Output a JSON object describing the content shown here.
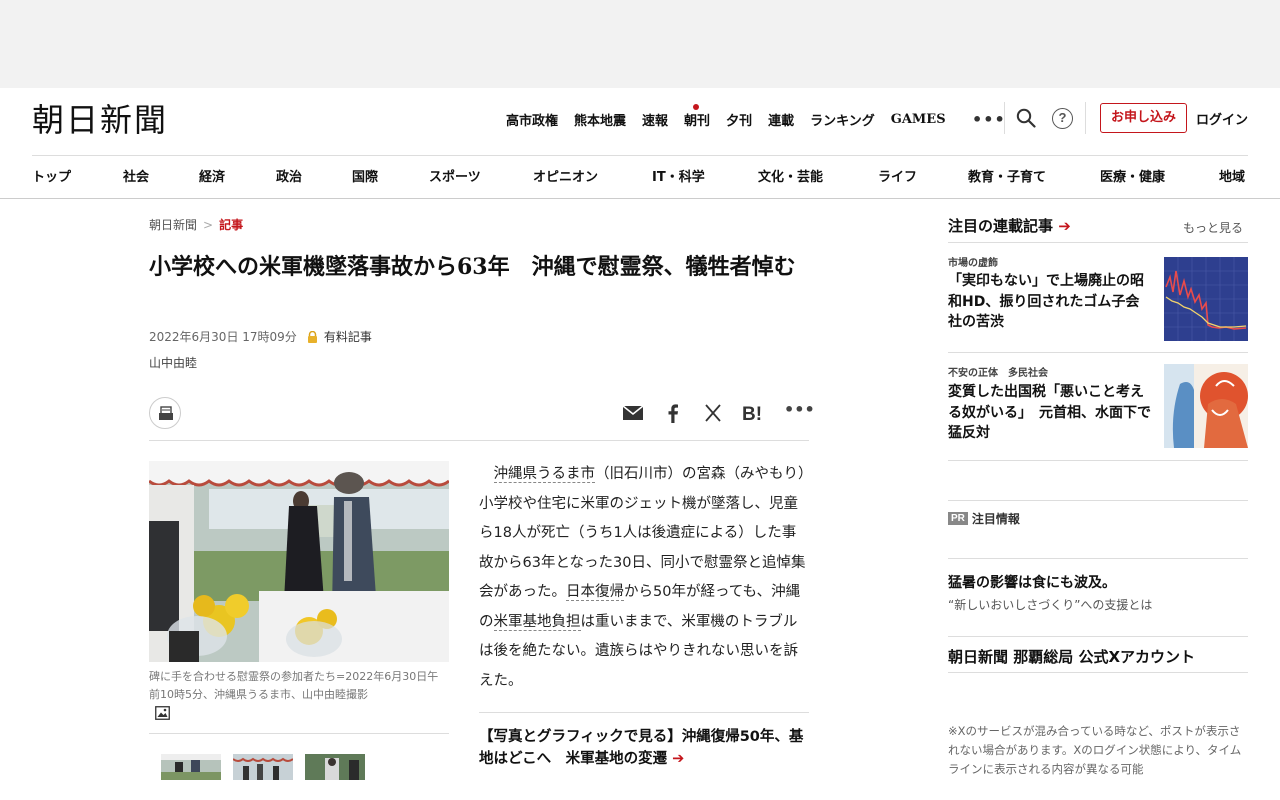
{
  "site": {
    "logo": "朝日新聞"
  },
  "top_nav": [
    "高市政権",
    "熊本地震",
    "速報",
    "朝刊",
    "夕刊",
    "連載",
    "ランキング",
    "GAMES"
  ],
  "header": {
    "more": "•••",
    "help": "?",
    "subscribe": "お申し込み",
    "login": "ログイン"
  },
  "category_nav": [
    "トップ",
    "社会",
    "経済",
    "政治",
    "国際",
    "スポーツ",
    "オピニオン",
    "IT・科学",
    "文化・芸能",
    "ライフ",
    "教育・子育て",
    "医療・健康",
    "地域"
  ],
  "breadcrumb": {
    "home": "朝日新聞",
    "separator": ">",
    "current": "記事"
  },
  "article": {
    "title": "小学校への米軍機墜落事故から63年　沖縄で慰霊祭、犠牲者悼む",
    "date": "2022年6月30日 17時09分",
    "paid_label": "有料記事",
    "author": "山中由睦",
    "share_more": "•••",
    "photo_caption": "碑に手を合わせる慰霊祭の参加者たち=2022年6月30日午前10時5分、沖縄県うるま市、山中由睦撮影",
    "body": {
      "link1": "沖縄県うるま市",
      "p1": "（旧石川市）の宮森（みやもり）小学校や住宅に米軍のジェット機が墜落し、児童ら18人が死亡（うち1人は後遺症による）した事故から63年となった30日、同小で慰霊祭と追悼集会があった。",
      "link2": "日本復帰",
      "p2": "から50年が経っても、沖縄の",
      "link3": "米軍基地負担",
      "p3": "は重いままで、米軍機のトラブルは後を絶たない。遺族らはやりきれない思いを訴えた。"
    },
    "related": "【写真とグラフィックで見る】沖縄復帰50年、基地はどこへ　米軍基地の変遷",
    "related_arrow": "➔"
  },
  "sidebar": {
    "title": "注目の連載記事",
    "title_arrow": "➔",
    "more": "もっと見る",
    "items": [
      {
        "category": "市場の虚飾",
        "headline": "「実印もない」で上場廃止の昭和HD、振り回されたゴム子会社の苦渋"
      },
      {
        "category": "不安の正体　多民社会",
        "headline": "変質した出国税「悪いこと考える奴がいる」　元首相、水面下で猛反対"
      }
    ],
    "pr_badge": "PR",
    "pr_label": "注目情報",
    "pr_headline": "猛暑の影響は食にも波及。",
    "pr_sub": "“新しいおいしさづくり”への支援とは",
    "x_account": "朝日新聞 那覇総局 公式Xアカウント",
    "note": "※Xのサービスが混み合っている時など、ポストが表示されない場合があります。Xのログイン状態により、タイムラインに表示される内容が異なる可能"
  },
  "colors": {
    "accent": "#c4161c",
    "rule": "#dddddd",
    "ad_bg": "#f2f2f2"
  }
}
